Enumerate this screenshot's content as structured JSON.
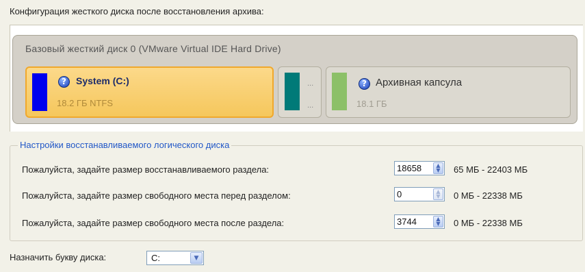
{
  "header": {
    "title": "Конфигурация жесткого диска после восстановления архива:"
  },
  "disk": {
    "title": "Базовый жесткий диск 0 (VMware Virtual IDE Hard Drive)",
    "partitions": [
      {
        "name": "System (C:)",
        "size": "18.2 ГБ NTFS",
        "color": "#0000ee",
        "selected": true
      },
      {
        "name": "",
        "size": "",
        "color": "#007a78",
        "dots_top": "...",
        "dots_bottom": "..."
      },
      {
        "name": "Архивная капсула",
        "size": "18.1 ГБ",
        "color": "#8cc068"
      }
    ]
  },
  "settings": {
    "group_title": "Настройки восстанавливаемого логического диска",
    "rows": [
      {
        "label": "Пожалуйста, задайте размер восстанавливаемого раздела:",
        "value": "18658",
        "range": "65 МБ - 22403 МБ"
      },
      {
        "label": "Пожалуйста, задайте размер свободного места перед разделом:",
        "value": "0",
        "range": "0 МБ - 22338 МБ"
      },
      {
        "label": "Пожалуйста, задайте размер свободного места после раздела:",
        "value": "3744",
        "range": "0 МБ - 22338 МБ"
      }
    ]
  },
  "drive_letter": {
    "label": "Назначить букву диска:",
    "value": "C:"
  },
  "icons": {
    "help": "help-icon",
    "spin": "spin-arrows-icon",
    "dropdown": "chevron-down-icon"
  },
  "colors": {
    "accent": "#2157c7",
    "selected_border": "#f0a82c"
  }
}
